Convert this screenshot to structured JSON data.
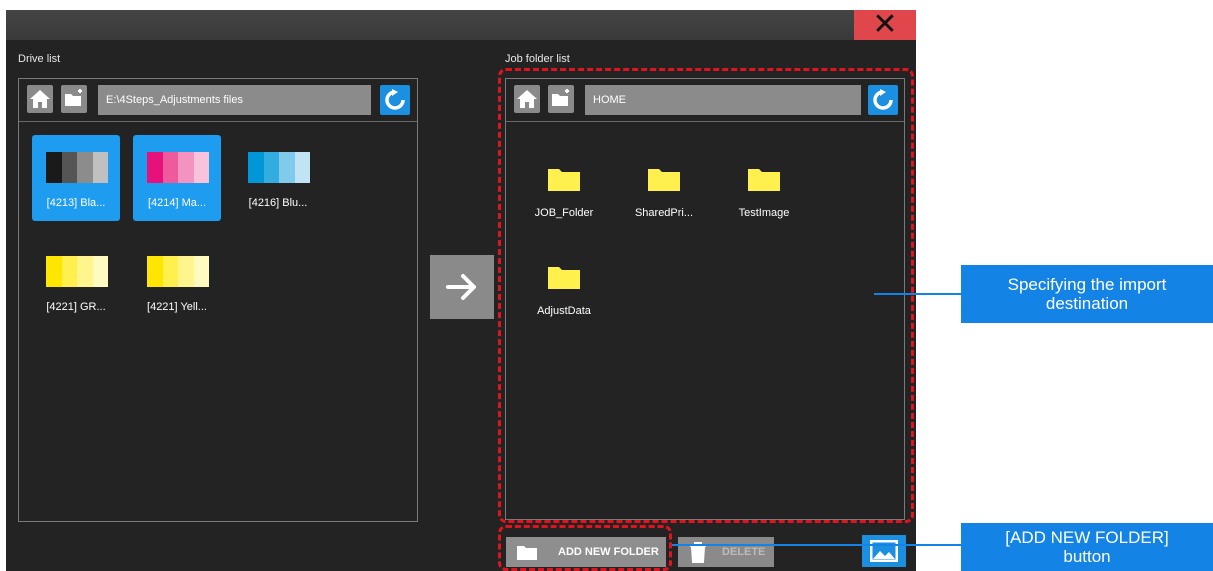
{
  "window": {
    "close_label": "✕"
  },
  "drive": {
    "label": "Drive list",
    "path": "E:\\4Steps_Adjustments files",
    "items": [
      {
        "label": "[4213] Bla...",
        "selected": true,
        "colors": [
          "#1a1a1a",
          "#555555",
          "#8c8c8c",
          "#c0c0c0"
        ]
      },
      {
        "label": "[4214] Ma...",
        "selected": true,
        "colors": [
          "#e6117a",
          "#ee5a9c",
          "#f493bf",
          "#f9c4db"
        ]
      },
      {
        "label": "[4216] Blu...",
        "selected": false,
        "colors": [
          "#0096d8",
          "#33addf",
          "#80cbec",
          "#c0e4f4"
        ]
      },
      {
        "label": "[4221] GR...",
        "selected": false,
        "colors": [
          "#ffe600",
          "#fff04d",
          "#fff58c",
          "#fffac0"
        ]
      },
      {
        "label": "[4221] Yell...",
        "selected": false,
        "colors": [
          "#ffe600",
          "#fff04d",
          "#fff58c",
          "#fffac0"
        ]
      }
    ]
  },
  "job": {
    "label": "Job folder list",
    "path": "HOME",
    "folders": [
      {
        "label": "JOB_Folder"
      },
      {
        "label": "SharedPri..."
      },
      {
        "label": "TestImage"
      },
      {
        "label": "AdjustData"
      }
    ]
  },
  "buttons": {
    "add_folder": "ADD NEW FOLDER",
    "delete": "DELETE"
  },
  "callouts": {
    "import": [
      "Specifying the import",
      "destination"
    ],
    "addfolder": [
      "[ADD NEW FOLDER]",
      "button"
    ]
  },
  "colors": {
    "accent": "#1b8fe0",
    "folder": "#fff04d",
    "highlight_dash": "#e0141e",
    "callout": "#1483e6"
  }
}
